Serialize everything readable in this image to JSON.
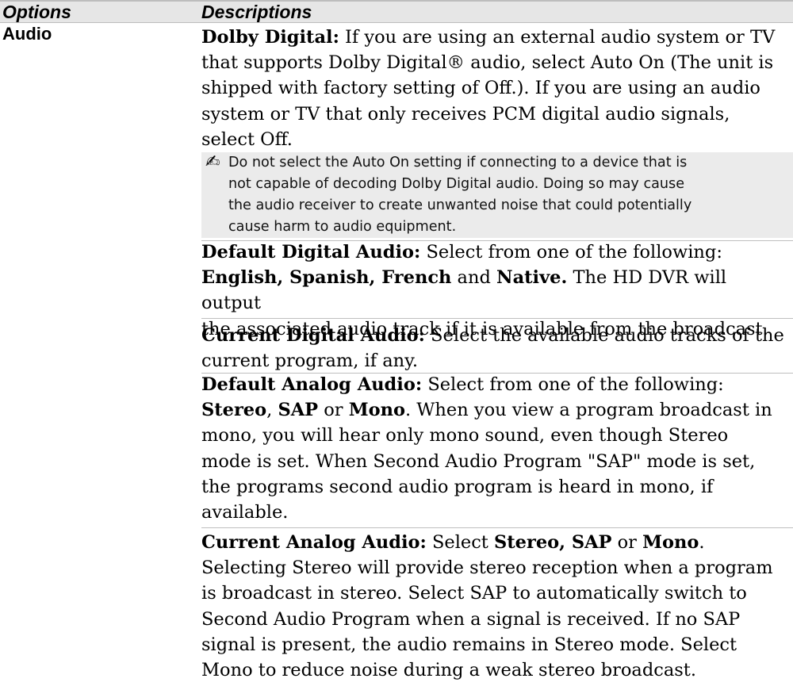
{
  "header": {
    "options_label": "Options",
    "descriptions_label": "Descriptions"
  },
  "option_name": "Audio",
  "dolby": {
    "title": "Dolby Digital:",
    "line1": "If you are using an external audio system or TV",
    "line2": "that supports Dolby Digital® audio, select Auto On (The unit is",
    "line3": "shipped with factory setting of Off.).  If you are using an audio",
    "line4": "system or TV that only receives PCM digital audio signals,",
    "line5": "select Off."
  },
  "note": {
    "icon": "pencil-note-icon",
    "line1": "Do not select the Auto On setting if connecting to a device that is",
    "line2": "not capable of decoding Dolby Digital audio.  Doing so may cause",
    "line3": "the audio receiver to create unwanted noise that could potentially",
    "line4": "cause harm to audio equipment."
  },
  "default_digital": {
    "title": "Default Digital Audio:",
    "line1_rest": "Select from one of the following:",
    "opt_english": "English",
    "opt_spanish": "Spanish",
    "opt_french": "French",
    "word_and": "and",
    "opt_native": "Native.",
    "line2_rest": "The HD DVR will output",
    "line3": "the associated audio track if it is available from the broadcast."
  },
  "current_digital": {
    "title": "Current Digital Audio:",
    "line1_rest": "Select the available audio tracks of the",
    "line2": "current program, if any."
  },
  "default_analog": {
    "title": "Default Analog Audio:",
    "line1_rest": "Select from one of the following:",
    "opt_stereo": "Stereo",
    "opt_sap": "SAP",
    "word_or": "or",
    "opt_mono": "Mono",
    "line2_rest": ".  When you view a program broadcast in",
    "line3": "mono, you will hear only mono sound, even though Stereo",
    "line4": "mode is set.  When Second Audio Program \"SAP\" mode is set,",
    "line5": "the programs second audio program is heard in mono, if",
    "line6": "available."
  },
  "current_analog": {
    "title": "Current Analog Audio:",
    "select_word": "Select",
    "opt_stereo_sap": "Stereo, SAP",
    "word_or": "or",
    "opt_mono": "Mono",
    "period": ".",
    "line2": "Selecting Stereo will provide stereo reception when a program",
    "line3": "is broadcast in stereo. Select SAP to automatically switch to",
    "line4": "Second Audio Program when a signal is received. If no SAP",
    "line5": "signal is present, the audio remains in Stereo mode. Select",
    "line6": "Mono to reduce noise during a weak stereo broadcast."
  }
}
